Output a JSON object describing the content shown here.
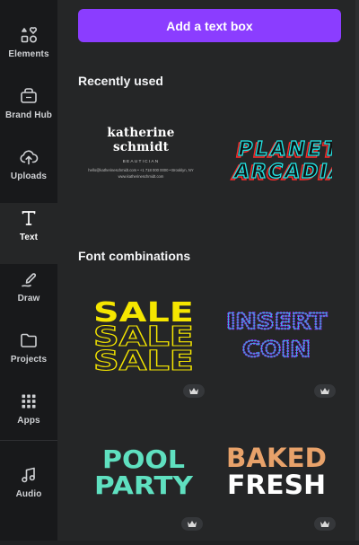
{
  "sidebar": {
    "items": [
      {
        "label": "Elements",
        "icon": "elements-icon"
      },
      {
        "label": "Brand Hub",
        "icon": "brand-hub-icon"
      },
      {
        "label": "Uploads",
        "icon": "uploads-icon"
      },
      {
        "label": "Text",
        "icon": "text-icon",
        "active": true
      },
      {
        "label": "Draw",
        "icon": "draw-icon"
      },
      {
        "label": "Projects",
        "icon": "projects-icon"
      },
      {
        "label": "Apps",
        "icon": "apps-icon"
      },
      {
        "label": "Audio",
        "icon": "audio-icon"
      }
    ]
  },
  "panel": {
    "add_text_label": "Add a text box",
    "recently_used_title": "Recently used",
    "font_combinations_title": "Font combinations"
  },
  "recent": {
    "katherine": {
      "name_line1": "katherine",
      "name_line2": "schmidt",
      "role": "BEAUTICIAN",
      "contact": "hello@katherineschmidt.com • +1 718 000 0000 • Brooklyn, NY",
      "website": "www.katherineschmidt.com"
    },
    "planet": {
      "line1": "PLANET",
      "line2": "ARCADIA"
    }
  },
  "combos": {
    "sale": {
      "line1": "SALE",
      "line2": "SALE",
      "line3": "SALE"
    },
    "insert": {
      "line1": "INSERT",
      "line2": "COIN"
    },
    "pool": {
      "line1": "POOL",
      "line2": "PARTY"
    },
    "baked": {
      "line1": "BAKED",
      "line2": "FRESH"
    }
  },
  "colors": {
    "accent": "#8b3dff",
    "rail_bg": "#18191b",
    "panel_bg": "#252627",
    "sale_yellow": "#f5e600",
    "pool_teal": "#5fe0c0",
    "baked_orange": "#e8a26a",
    "insert_purple": "#8b2be2"
  }
}
